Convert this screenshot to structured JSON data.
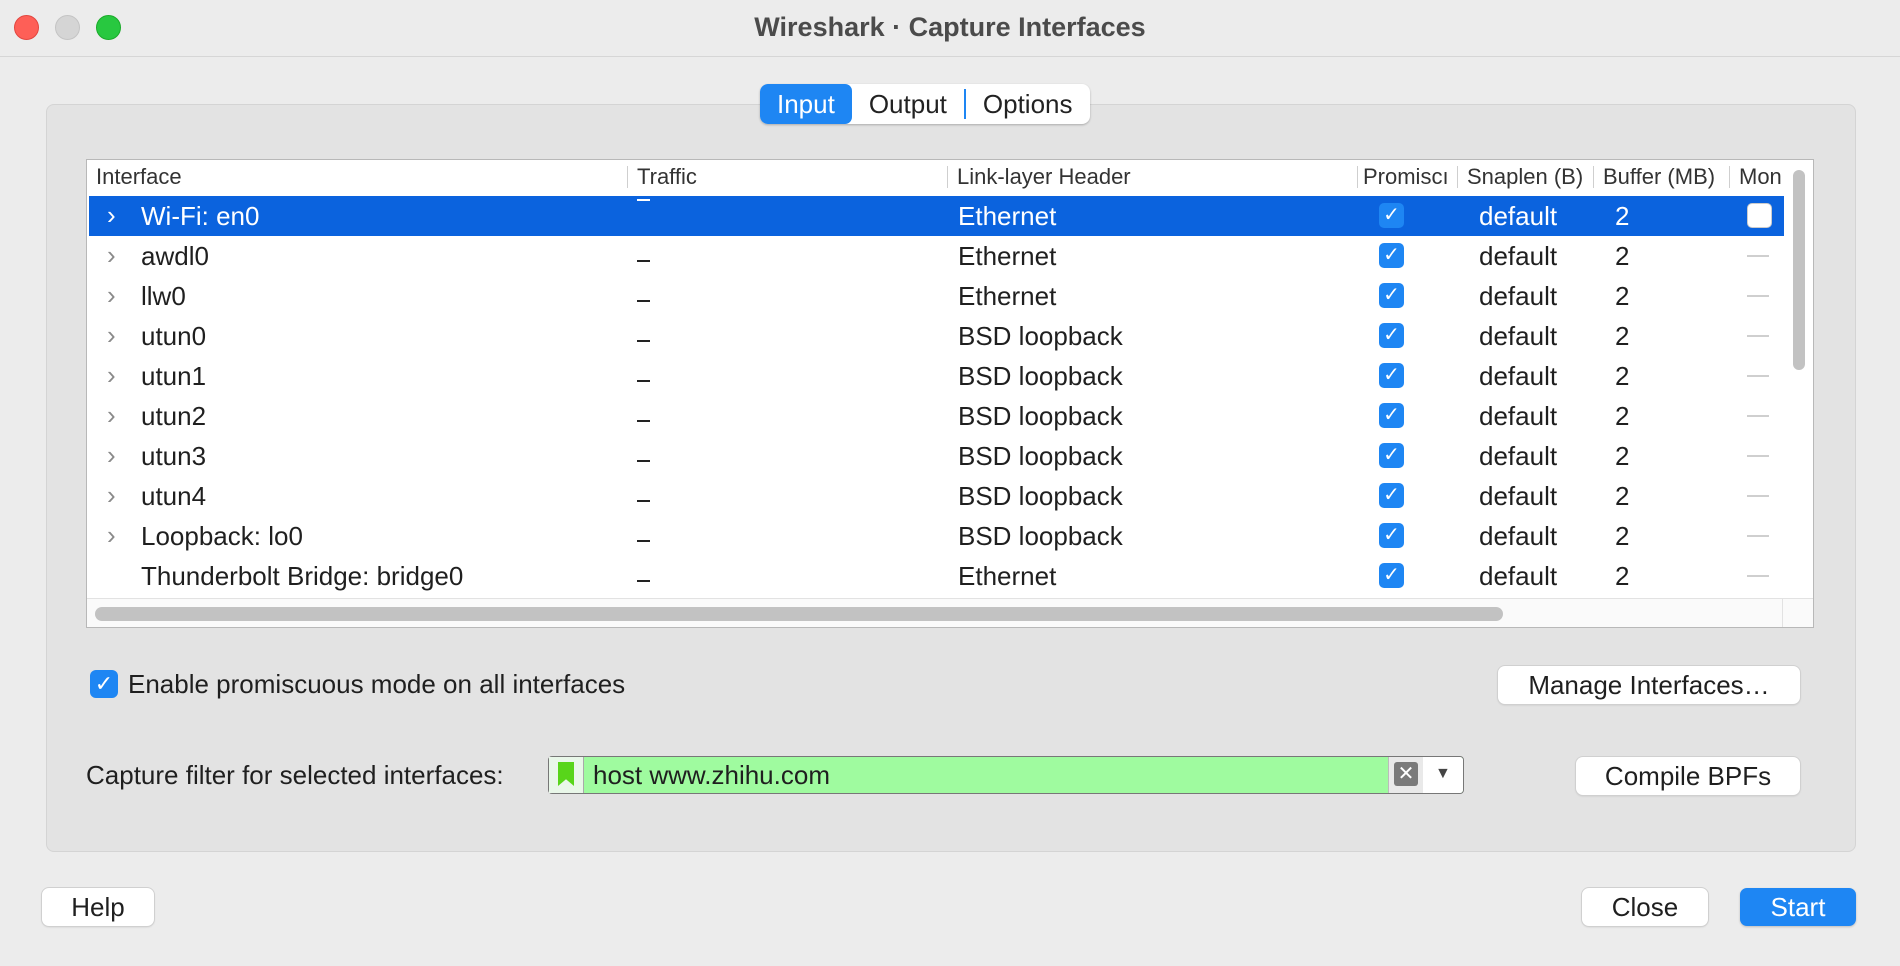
{
  "window": {
    "title": "Wireshark · Capture Interfaces"
  },
  "tabs": [
    {
      "label": "Input",
      "active": true
    },
    {
      "label": "Output",
      "active": false
    },
    {
      "label": "Options",
      "active": false
    }
  ],
  "table": {
    "headers": [
      "Interface",
      "Traffic",
      "Link-layer Header",
      "Promiscı",
      "Snaplen (B)",
      "Buffer (MB)",
      "Mon"
    ],
    "rows": [
      {
        "interface": "Wi-Fi: en0",
        "expandable": true,
        "traffic": "—",
        "link": "Ethernet",
        "promisc": true,
        "snaplen": "default",
        "buffer": "2",
        "monitor": "checkbox-off",
        "selected": true
      },
      {
        "interface": "awdl0",
        "expandable": true,
        "traffic": "_",
        "link": "Ethernet",
        "promisc": true,
        "snaplen": "default",
        "buffer": "2",
        "monitor": "—",
        "selected": false
      },
      {
        "interface": "llw0",
        "expandable": true,
        "traffic": "_",
        "link": "Ethernet",
        "promisc": true,
        "snaplen": "default",
        "buffer": "2",
        "monitor": "—",
        "selected": false
      },
      {
        "interface": "utun0",
        "expandable": true,
        "traffic": "_",
        "link": "BSD loopback",
        "promisc": true,
        "snaplen": "default",
        "buffer": "2",
        "monitor": "—",
        "selected": false
      },
      {
        "interface": "utun1",
        "expandable": true,
        "traffic": "_",
        "link": "BSD loopback",
        "promisc": true,
        "snaplen": "default",
        "buffer": "2",
        "monitor": "—",
        "selected": false
      },
      {
        "interface": "utun2",
        "expandable": true,
        "traffic": "_",
        "link": "BSD loopback",
        "promisc": true,
        "snaplen": "default",
        "buffer": "2",
        "monitor": "—",
        "selected": false
      },
      {
        "interface": "utun3",
        "expandable": true,
        "traffic": "_",
        "link": "BSD loopback",
        "promisc": true,
        "snaplen": "default",
        "buffer": "2",
        "monitor": "—",
        "selected": false
      },
      {
        "interface": "utun4",
        "expandable": true,
        "traffic": "_",
        "link": "BSD loopback",
        "promisc": true,
        "snaplen": "default",
        "buffer": "2",
        "monitor": "—",
        "selected": false
      },
      {
        "interface": "Loopback: lo0",
        "expandable": true,
        "traffic": "_",
        "link": "BSD loopback",
        "promisc": true,
        "snaplen": "default",
        "buffer": "2",
        "monitor": "—",
        "selected": false
      },
      {
        "interface": "Thunderbolt Bridge: bridge0",
        "expandable": false,
        "traffic": "_",
        "link": "Ethernet",
        "promisc": true,
        "snaplen": "default",
        "buffer": "2",
        "monitor": "—",
        "selected": false
      }
    ]
  },
  "options": {
    "promisc_all_label": "Enable promiscuous mode on all interfaces",
    "promisc_all_checked": true,
    "manage_button": "Manage Interfaces…",
    "filter_label": "Capture filter for selected interfaces:",
    "filter_value": "host www.zhihu.com",
    "compile_button": "Compile BPFs"
  },
  "footer": {
    "help_button": "Help",
    "close_button": "Close",
    "start_button": "Start"
  },
  "colors": {
    "accent": "#1e86f3",
    "selected_row": "#0b63de",
    "filter_valid_bg": "#9ffb9f"
  },
  "icons": {
    "expand": "chevron-right-icon",
    "check": "checkmark-icon",
    "bookmark": "bookmark-icon",
    "clear": "clear-x-icon",
    "dropdown": "triangle-down-icon"
  }
}
